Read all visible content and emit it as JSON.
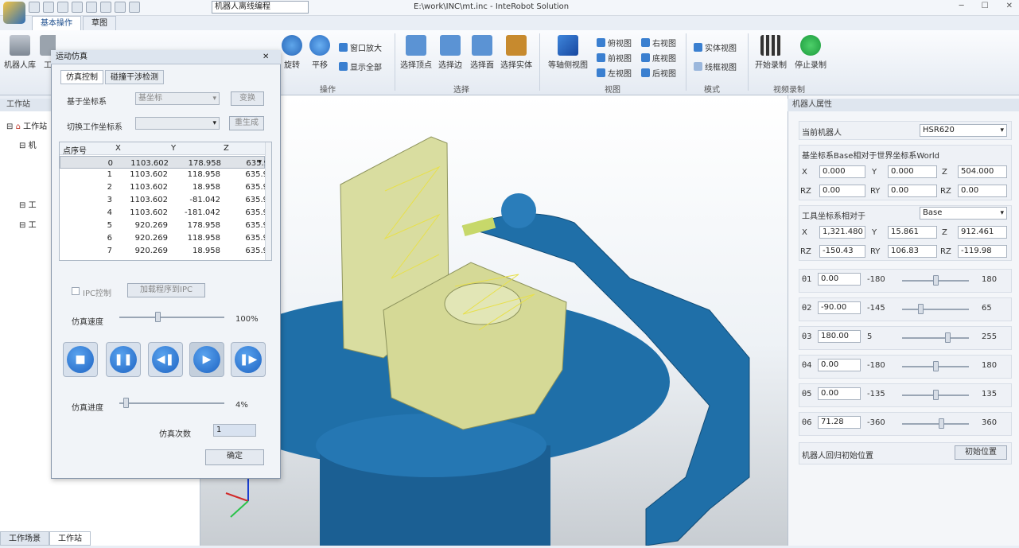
{
  "app": {
    "window_title": "E:\\work\\INC\\mt.inc - InteRobot Solution",
    "project_select": "机器人离线编程"
  },
  "tabs": [
    "基本操作",
    "草图"
  ],
  "ribbon": {
    "left_buttons": [
      "机器人库",
      "工"
    ],
    "view_buttons": {
      "rotate": "旋转",
      "pan": "平移",
      "zoom_window": "窗口放大",
      "show_all": "显示全部"
    },
    "group_operation": "操作",
    "select_buttons": [
      "选择顶点",
      "选择边",
      "选择面",
      "选择实体"
    ],
    "group_select": "选择",
    "isometric": "等轴侧视图",
    "views": [
      "俯视图",
      "右视图",
      "前视图",
      "底视图",
      "左视图",
      "后视图"
    ],
    "group_view": "视图",
    "mode_buttons": [
      "实体视图",
      "线框视图"
    ],
    "group_mode": "模式",
    "record_buttons": [
      "开始录制",
      "停止录制"
    ],
    "group_record": "视频录制"
  },
  "left_panel": {
    "title": "工作站",
    "tree": [
      "工作站",
      "机",
      "工",
      "工"
    ],
    "bottom_tabs": [
      "工作场景",
      "工作站"
    ]
  },
  "dialog": {
    "title": "运动仿真",
    "tabs": [
      "仿真控制",
      "碰撞干涉检测"
    ],
    "base_frame_label": "基于坐标系",
    "base_frame_value": "基坐标",
    "transform_btn": "变换",
    "switch_frame_label": "切换工作坐标系",
    "regenerate_btn": "重生成",
    "grid_headers": [
      "点序号",
      "X",
      "Y",
      "Z"
    ],
    "grid_rows": [
      [
        "0",
        "1103.602",
        "178.958",
        "635.9"
      ],
      [
        "1",
        "1103.602",
        "118.958",
        "635.9"
      ],
      [
        "2",
        "1103.602",
        "18.958",
        "635.9"
      ],
      [
        "3",
        "1103.602",
        "-81.042",
        "635.9"
      ],
      [
        "4",
        "1103.602",
        "-181.042",
        "635.9"
      ],
      [
        "5",
        "920.269",
        "178.958",
        "635.9"
      ],
      [
        "6",
        "920.269",
        "118.958",
        "635.9"
      ],
      [
        "7",
        "920.269",
        "18.958",
        "635.9"
      ]
    ],
    "ipc_label": "IPC控制",
    "load_ipc_btn": "加载程序到IPC",
    "speed_label": "仿真速度",
    "speed_value": "100%",
    "speed_fraction": 0.36,
    "progress_label": "仿真进度",
    "progress_value": "4%",
    "progress_fraction": 0.04,
    "count_label": "仿真次数",
    "count_value": "1",
    "ok_btn": "确定"
  },
  "right_panel": {
    "title": "机器人属性",
    "current_robot_label": "当前机器人",
    "current_robot": "HSR620",
    "base_header": "基坐标系Base相对于世界坐标系World",
    "base": {
      "X": "0.000",
      "Y": "0.000",
      "Z": "504.000",
      "RZ": "0.00",
      "RY": "0.00",
      "RZ2": "0.00"
    },
    "tool_header": "工具坐标系相对于",
    "tool_ref": "Base",
    "tool": {
      "X": "1,321.480",
      "Y": "15.861",
      "Z": "912.461",
      "RZ": "-150.43",
      "RY": "106.83",
      "RZ2": "-119.98"
    },
    "axis_labels": {
      "X": "X",
      "Y": "Y",
      "Z": "Z",
      "RZ": "RZ",
      "RY": "RY"
    },
    "joints": [
      {
        "name": "θ1",
        "value": "0.00",
        "min": "-180",
        "max": "180",
        "fraction": 0.5
      },
      {
        "name": "θ2",
        "value": "-90.00",
        "min": "-145",
        "max": "65",
        "fraction": 0.26
      },
      {
        "name": "θ3",
        "value": "180.00",
        "min": "5",
        "max": "255",
        "fraction": 0.7
      },
      {
        "name": "θ4",
        "value": "0.00",
        "min": "-180",
        "max": "180",
        "fraction": 0.5
      },
      {
        "name": "θ5",
        "value": "0.00",
        "min": "-135",
        "max": "135",
        "fraction": 0.5
      },
      {
        "name": "θ6",
        "value": "71.28",
        "min": "-360",
        "max": "360",
        "fraction": 0.6
      }
    ],
    "reset_label": "机器人回归初始位置",
    "reset_btn": "初始位置"
  },
  "colors": {
    "robot": "#1f6fa8",
    "part": "#d9dda0",
    "accent": "#1e63c2"
  },
  "icons": {
    "play": "play-icon",
    "pause": "pause-icon",
    "stop": "stop-icon"
  }
}
